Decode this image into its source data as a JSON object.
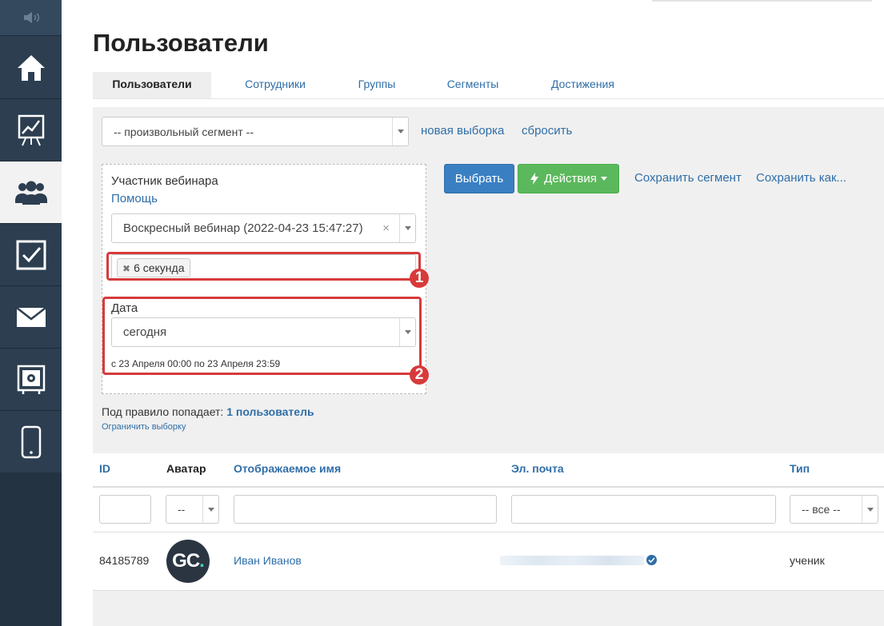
{
  "sidebar": {
    "items": [
      {
        "icon": "speaker-icon"
      },
      {
        "icon": "home-icon"
      },
      {
        "icon": "chart-icon"
      },
      {
        "icon": "users-icon"
      },
      {
        "icon": "task-icon"
      },
      {
        "icon": "mail-icon"
      },
      {
        "icon": "settings-panel-icon"
      },
      {
        "icon": "mobile-icon"
      }
    ],
    "colors": {
      "bg": "#2c3e50",
      "active_bg": "#f2f2f2"
    }
  },
  "page": {
    "title": "Пользователи"
  },
  "tabs": [
    {
      "label": "Пользователи",
      "active": true
    },
    {
      "label": "Сотрудники"
    },
    {
      "label": "Группы"
    },
    {
      "label": "Сегменты"
    },
    {
      "label": "Достижения"
    }
  ],
  "filter": {
    "segment_select": "-- произвольный сегмент --",
    "new_selection_link": "новая выборка",
    "reset_link": "сбросить",
    "rule": {
      "title": "Участник вебинара",
      "help_link": "Помощь",
      "webinar_select": "Воскресный вебинар (2022-04-23 15:47:27)",
      "clear_symbol": "×",
      "tag": "6 секунда",
      "tag_remove": "✖",
      "date_label": "Дата",
      "date_select": "сегодня",
      "date_range": "с 23 Апреля 00:00 по 23 Апреля 23:59"
    },
    "annotations": [
      "1",
      "2"
    ],
    "buttons": {
      "select": "Выбрать",
      "actions": "Действия",
      "save_segment": "Сохранить сегмент",
      "save_as": "Сохранить как..."
    },
    "result_prefix": "Под правило попадает:",
    "result_count": "1 пользователь",
    "limit_link": "Ограничить выборку"
  },
  "table": {
    "headers": {
      "id": "ID",
      "avatar": "Аватар",
      "name": "Отображаемое имя",
      "email": "Эл. почта",
      "type": "Тип"
    },
    "avatar_filter": "--",
    "type_filter": "-- все --",
    "rows": [
      {
        "id": "84185789",
        "avatar_text": "GC",
        "avatar_dot": ".",
        "name": "Иван Иванов",
        "type": "ученик"
      }
    ]
  }
}
